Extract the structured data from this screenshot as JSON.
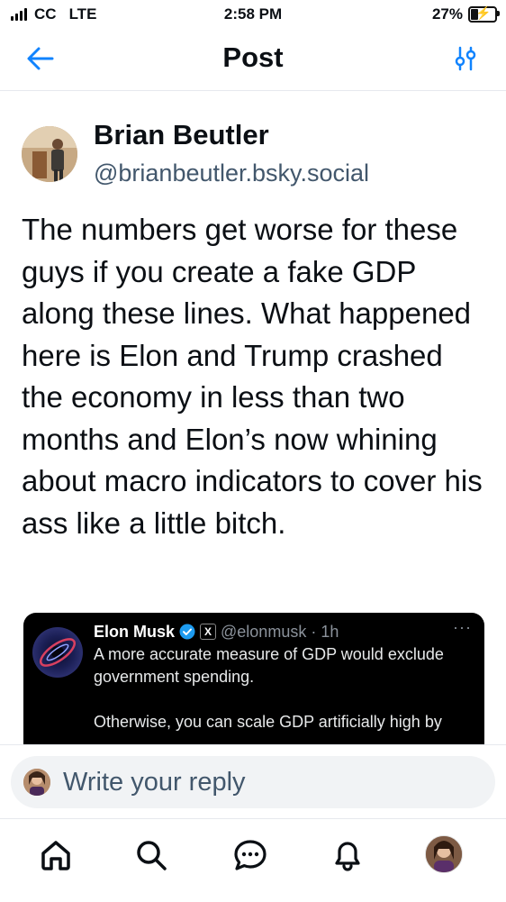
{
  "status_bar": {
    "carrier": "CC",
    "network": "LTE",
    "time": "2:58 PM",
    "battery_percent": "27%",
    "battery_level": 0.27
  },
  "header": {
    "title": "Post",
    "back_icon": "arrow-left-icon",
    "settings_icon": "sliders-icon"
  },
  "post": {
    "author_name": "Brian Beutler",
    "author_handle": "@brianbeutler.bsky.social",
    "text": "The numbers get worse for these guys if you create a fake GDP along these lines. What happened here is Elon and Trump crashed the economy in less than two months and Elon’s now whining about macro indicators to cover his ass like a little bitch."
  },
  "embed": {
    "name": "Elon Musk",
    "x_badge": "X",
    "handle": "@elonmusk",
    "time": "· 1h",
    "more": "···",
    "paragraph1": "A more accurate measure of GDP would exclude government spending.",
    "paragraph2": "Otherwise, you can scale GDP artificially high by",
    "colors": {
      "background": "#000000",
      "text": "#e7e9ea",
      "verified": "#1d9bf0"
    }
  },
  "reply": {
    "placeholder": "Write your reply"
  },
  "bottom_nav": {
    "items": [
      {
        "icon": "home-icon"
      },
      {
        "icon": "search-icon"
      },
      {
        "icon": "chat-icon"
      },
      {
        "icon": "bell-icon"
      },
      {
        "icon": "profile-avatar"
      }
    ]
  },
  "colors": {
    "accent": "#1083fe",
    "handle_gray": "#42576c",
    "divider": "#e6e9ee"
  }
}
